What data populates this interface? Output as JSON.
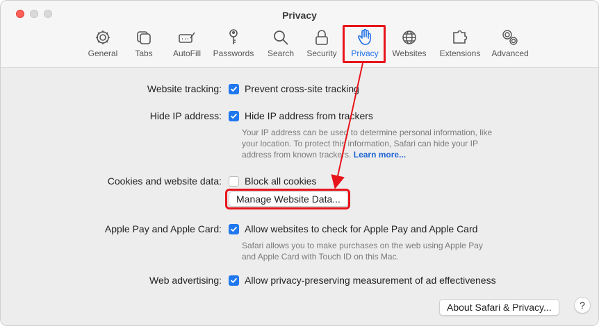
{
  "window": {
    "title": "Privacy"
  },
  "tabs": [
    {
      "label": "General",
      "icon": "gear-icon"
    },
    {
      "label": "Tabs",
      "icon": "tabs-icon"
    },
    {
      "label": "AutoFill",
      "icon": "autofill-icon"
    },
    {
      "label": "Passwords",
      "icon": "key-icon"
    },
    {
      "label": "Search",
      "icon": "search-icon"
    },
    {
      "label": "Security",
      "icon": "lock-icon"
    },
    {
      "label": "Privacy",
      "icon": "hand-icon",
      "active": true
    },
    {
      "label": "Websites",
      "icon": "globe-icon"
    },
    {
      "label": "Extensions",
      "icon": "puzzle-icon"
    },
    {
      "label": "Advanced",
      "icon": "gears-icon"
    }
  ],
  "settings": {
    "tracking": {
      "label": "Website tracking:",
      "option": "Prevent cross-site tracking",
      "checked": true
    },
    "hide_ip": {
      "label": "Hide IP address:",
      "option": "Hide IP address from trackers",
      "checked": true,
      "desc_line1": "Your IP address can be used to determine personal information, like",
      "desc_line2": "your location. To protect this information, Safari can hide your IP",
      "desc_line3": "address from known trackers.",
      "learn_more": "Learn more..."
    },
    "cookies": {
      "label": "Cookies and website data:",
      "option": "Block all cookies",
      "checked": false,
      "manage_button": "Manage Website Data..."
    },
    "apple_pay": {
      "label": "Apple Pay and Apple Card:",
      "option": "Allow websites to check for Apple Pay and Apple Card",
      "checked": true,
      "desc_line1": "Safari allows you to make purchases on the web using Apple Pay",
      "desc_line2": "and Apple Card with Touch ID on this Mac."
    },
    "ads": {
      "label": "Web advertising:",
      "option": "Allow privacy-preserving measurement of ad effectiveness",
      "checked": true
    }
  },
  "footer": {
    "about_button": "About Safari & Privacy...",
    "help": "?"
  },
  "colors": {
    "accent": "#1f78f0",
    "annotation": "#e8141b"
  }
}
